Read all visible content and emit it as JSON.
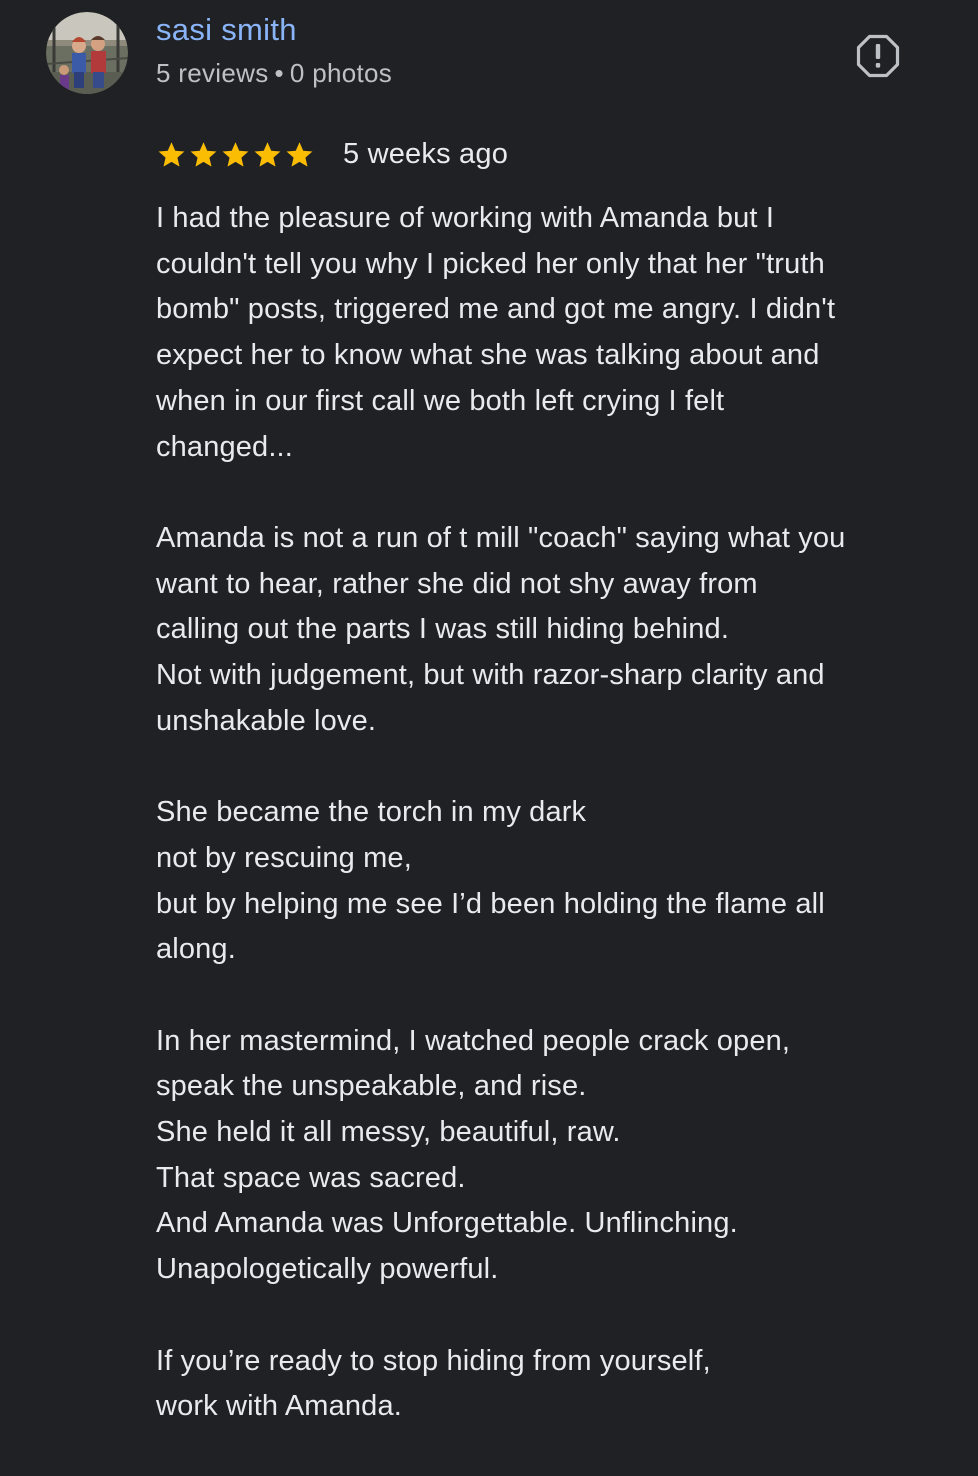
{
  "review": {
    "author": {
      "name": "sasi smith",
      "reviews_count": "5 reviews",
      "separator": "•",
      "photos_count": "0 photos"
    },
    "rating": 5,
    "date": "5 weeks ago",
    "colors": {
      "name_link": "#8ab4f8",
      "star": "#fbbc04",
      "background": "#202124"
    },
    "icons": {
      "report": "report-flag-icon",
      "star": "star-icon"
    },
    "body": {
      "p1": [
        "I had the pleasure of working with Amanda but I",
        "couldn't tell you why I picked her only that her \"truth",
        "bomb\" posts, triggered me and got me angry. I didn't",
        "expect her to know what she was talking about and",
        "when in our first call we both left crying I felt",
        "changed..."
      ],
      "p2": [
        "Amanda is not a run of t mill \"coach\" saying what you",
        "want to hear, rather she did not shy away from",
        "calling out the parts I was still hiding behind.",
        "Not with judgement, but with razor-sharp clarity and",
        "unshakable love."
      ],
      "p3": [
        "She became the torch in my dark",
        "not by rescuing me,",
        "but by helping me see I’d been holding the flame all",
        "along."
      ],
      "p4": [
        "In her mastermind, I watched people crack open,",
        "speak the unspeakable, and rise.",
        "She held it all messy, beautiful, raw.",
        "That space was sacred.",
        "And Amanda was Unforgettable. Unflinching.",
        "Unapologetically powerful."
      ],
      "p5": [
        "If you’re ready to stop hiding from yourself,",
        "work with Amanda."
      ]
    }
  }
}
